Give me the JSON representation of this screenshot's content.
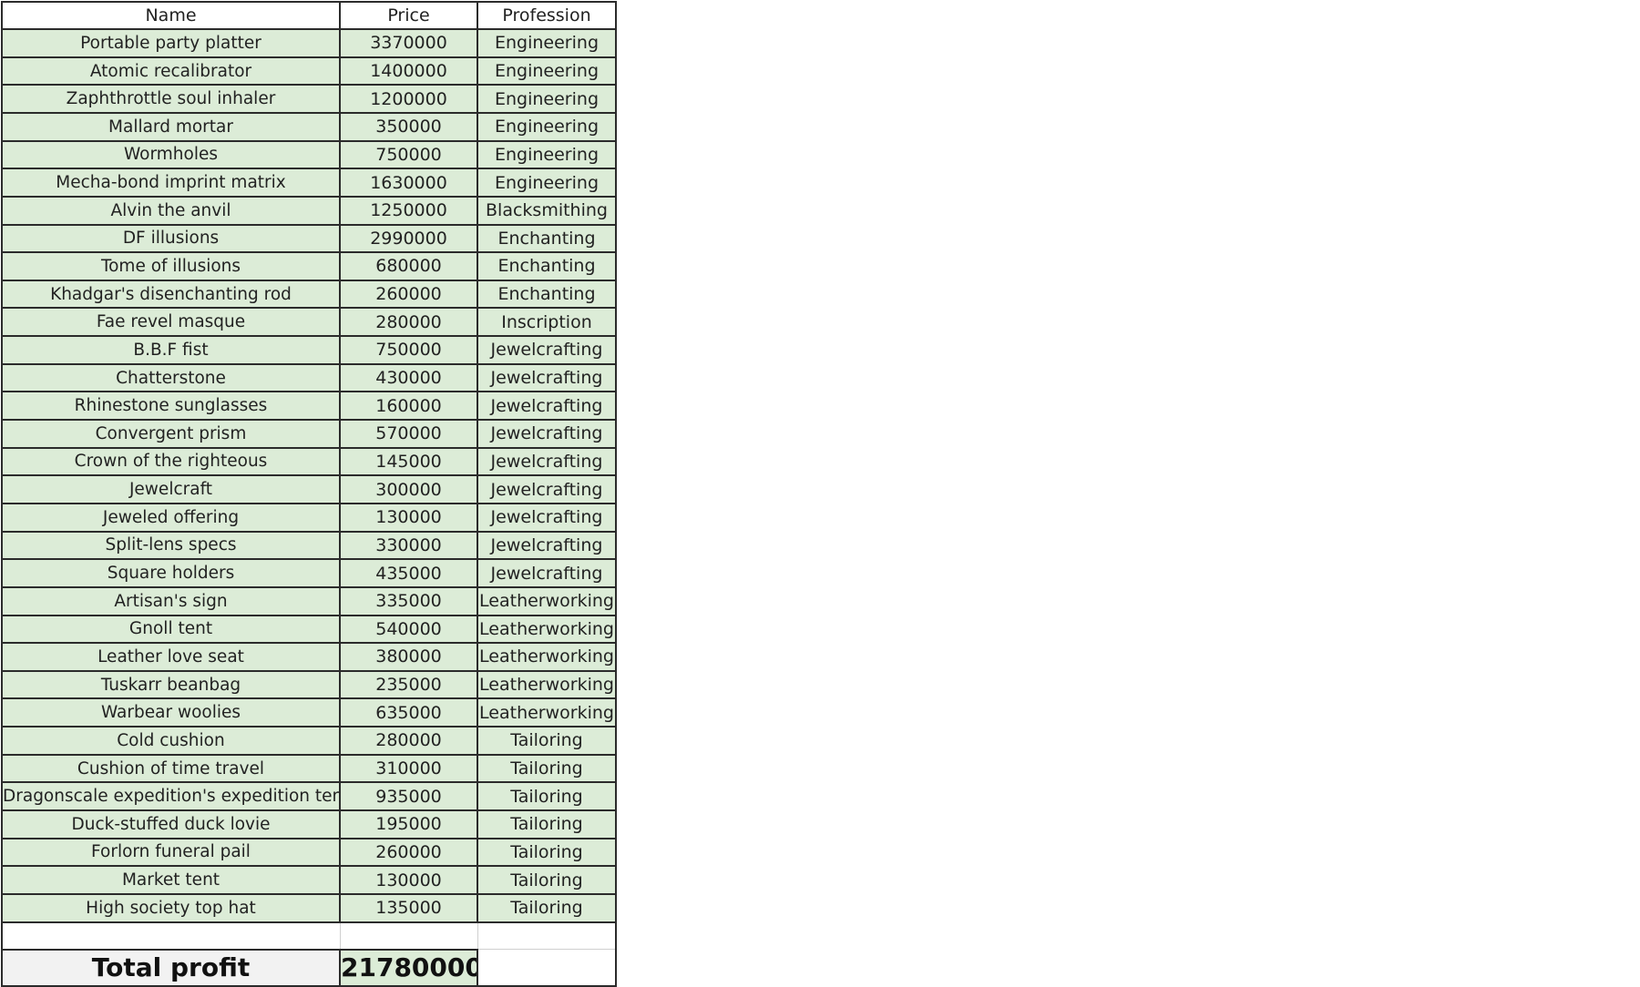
{
  "table": {
    "headers": [
      "Name",
      "Price",
      "Profession"
    ],
    "rows": [
      [
        "Portable party platter",
        "3370000",
        "Engineering"
      ],
      [
        "Atomic recalibrator",
        "1400000",
        "Engineering"
      ],
      [
        "Zaphthrottle soul inhaler",
        "1200000",
        "Engineering"
      ],
      [
        "Mallard mortar",
        "350000",
        "Engineering"
      ],
      [
        "Wormholes",
        "750000",
        "Engineering"
      ],
      [
        "Mecha-bond imprint matrix",
        "1630000",
        "Engineering"
      ],
      [
        "Alvin the anvil",
        "1250000",
        "Blacksmithing"
      ],
      [
        "DF illusions",
        "2990000",
        "Enchanting"
      ],
      [
        "Tome of illusions",
        "680000",
        "Enchanting"
      ],
      [
        "Khadgar's disenchanting rod",
        "260000",
        "Enchanting"
      ],
      [
        "Fae revel masque",
        "280000",
        "Inscription"
      ],
      [
        "B.B.F fist",
        "750000",
        "Jewelcrafting"
      ],
      [
        "Chatterstone",
        "430000",
        "Jewelcrafting"
      ],
      [
        "Rhinestone sunglasses",
        "160000",
        "Jewelcrafting"
      ],
      [
        "Convergent prism",
        "570000",
        "Jewelcrafting"
      ],
      [
        "Crown of the righteous",
        "145000",
        "Jewelcrafting"
      ],
      [
        "Jewelcraft",
        "300000",
        "Jewelcrafting"
      ],
      [
        "Jeweled offering",
        "130000",
        "Jewelcrafting"
      ],
      [
        "Split-lens specs",
        "330000",
        "Jewelcrafting"
      ],
      [
        "Square holders",
        "435000",
        "Jewelcrafting"
      ],
      [
        "Artisan's sign",
        "335000",
        "Leatherworking"
      ],
      [
        "Gnoll tent",
        "540000",
        "Leatherworking"
      ],
      [
        "Leather love seat",
        "380000",
        "Leatherworking"
      ],
      [
        "Tuskarr beanbag",
        "235000",
        "Leatherworking"
      ],
      [
        "Warbear woolies",
        "635000",
        "Leatherworking"
      ],
      [
        "Cold cushion",
        "280000",
        "Tailoring"
      ],
      [
        "Cushion of time travel",
        "310000",
        "Tailoring"
      ],
      [
        "Dragonscale expedition's expedition tent",
        "935000",
        "Tailoring"
      ],
      [
        "Duck-stuffed duck lovie",
        "195000",
        "Tailoring"
      ],
      [
        "Forlorn funeral pail",
        "260000",
        "Tailoring"
      ],
      [
        "Market tent",
        "130000",
        "Tailoring"
      ],
      [
        "High society top hat",
        "135000",
        "Tailoring"
      ]
    ],
    "total_label": "Total profit",
    "total_value": "21780000"
  }
}
